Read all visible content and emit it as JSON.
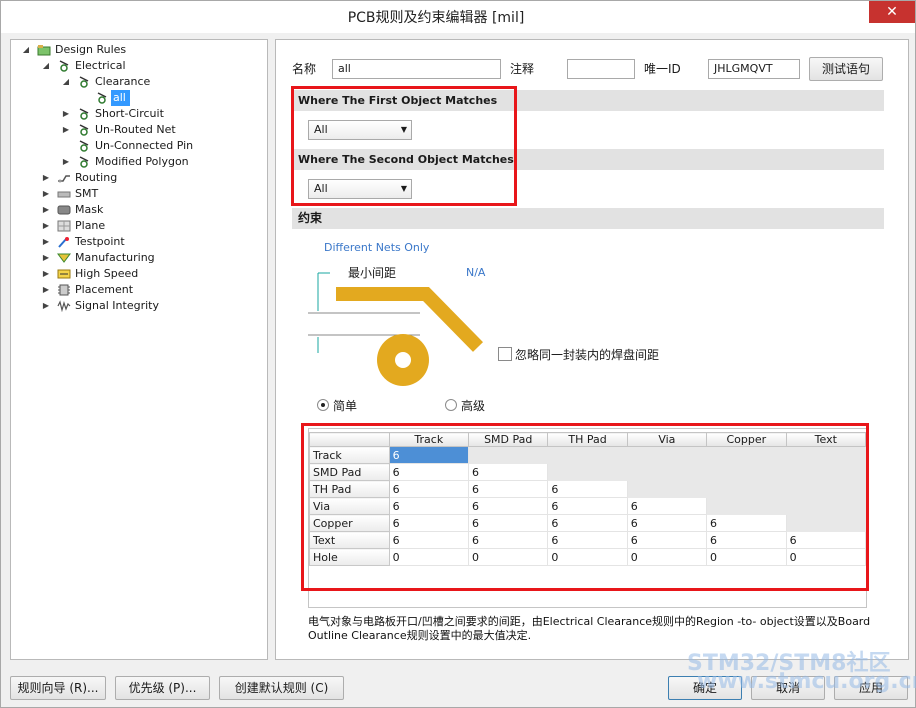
{
  "window": {
    "title": "PCB规则及约束编辑器 [mil]",
    "close_glyph": "✕"
  },
  "tree": {
    "root": "Design Rules",
    "electrical": "Electrical",
    "clearance": "Clearance",
    "all": "all",
    "short_circuit": "Short-Circuit",
    "un_routed_net": "Un-Routed Net",
    "un_connected_pin": "Un-Connected Pin",
    "modified_polygon": "Modified Polygon",
    "routing": "Routing",
    "smt": "SMT",
    "mask": "Mask",
    "plane": "Plane",
    "testpoint": "Testpoint",
    "manufacturing": "Manufacturing",
    "high_speed": "High Speed",
    "placement": "Placement",
    "signal_integrity": "Signal Integrity"
  },
  "rule_header": {
    "name_label": "名称",
    "name_value": "all",
    "comment_label": "注释",
    "comment_value": "",
    "uid_label": "唯一ID",
    "uid_value": "JHLGMQVT",
    "test_button": "测试语句"
  },
  "first_match": {
    "title": "Where The First Object Matches",
    "value": "All"
  },
  "second_match": {
    "title": "Where The Second Object Matches",
    "value": "All"
  },
  "constraints": {
    "title": "约束",
    "net_scope": "Different Nets Only",
    "min_clearance_label": "最小间距",
    "min_clearance_value": "N/A",
    "ignore_pad_label": "忽略同一封装内的焊盘间距",
    "mode_simple": "简单",
    "mode_advanced": "高级",
    "mode_selected": "simple"
  },
  "clearance_grid": {
    "columns": [
      "Track",
      "SMD Pad",
      "TH Pad",
      "Via",
      "Copper",
      "Text"
    ],
    "rows": [
      {
        "label": "Track",
        "cells": [
          "6"
        ]
      },
      {
        "label": "SMD Pad",
        "cells": [
          "6",
          "6"
        ]
      },
      {
        "label": "TH Pad",
        "cells": [
          "6",
          "6",
          "6"
        ]
      },
      {
        "label": "Via",
        "cells": [
          "6",
          "6",
          "6",
          "6"
        ]
      },
      {
        "label": "Copper",
        "cells": [
          "6",
          "6",
          "6",
          "6",
          "6"
        ]
      },
      {
        "label": "Text",
        "cells": [
          "6",
          "6",
          "6",
          "6",
          "6",
          "6"
        ]
      },
      {
        "label": "Hole",
        "cells": [
          "0",
          "0",
          "0",
          "0",
          "0",
          "0"
        ]
      }
    ]
  },
  "description": "电气对象与电路板开口/凹槽之间要求的间距，由Electrical Clearance规则中的Region -to- object设置以及Board Outline Clearance规则设置中的最大值决定.",
  "footer": {
    "wizard": "规则向导 (R)...",
    "priority": "优先级 (P)...",
    "create_default": "创建默认规则 (C)",
    "ok": "确定",
    "cancel": "取消",
    "apply": "应用"
  },
  "watermark": {
    "line1": "STM32/STM8社区",
    "line2": "www.stmcu.org.cn"
  },
  "colors": {
    "accent": "#3399ff",
    "highlight_box": "#e8161a",
    "trace": "#e3a91f"
  }
}
